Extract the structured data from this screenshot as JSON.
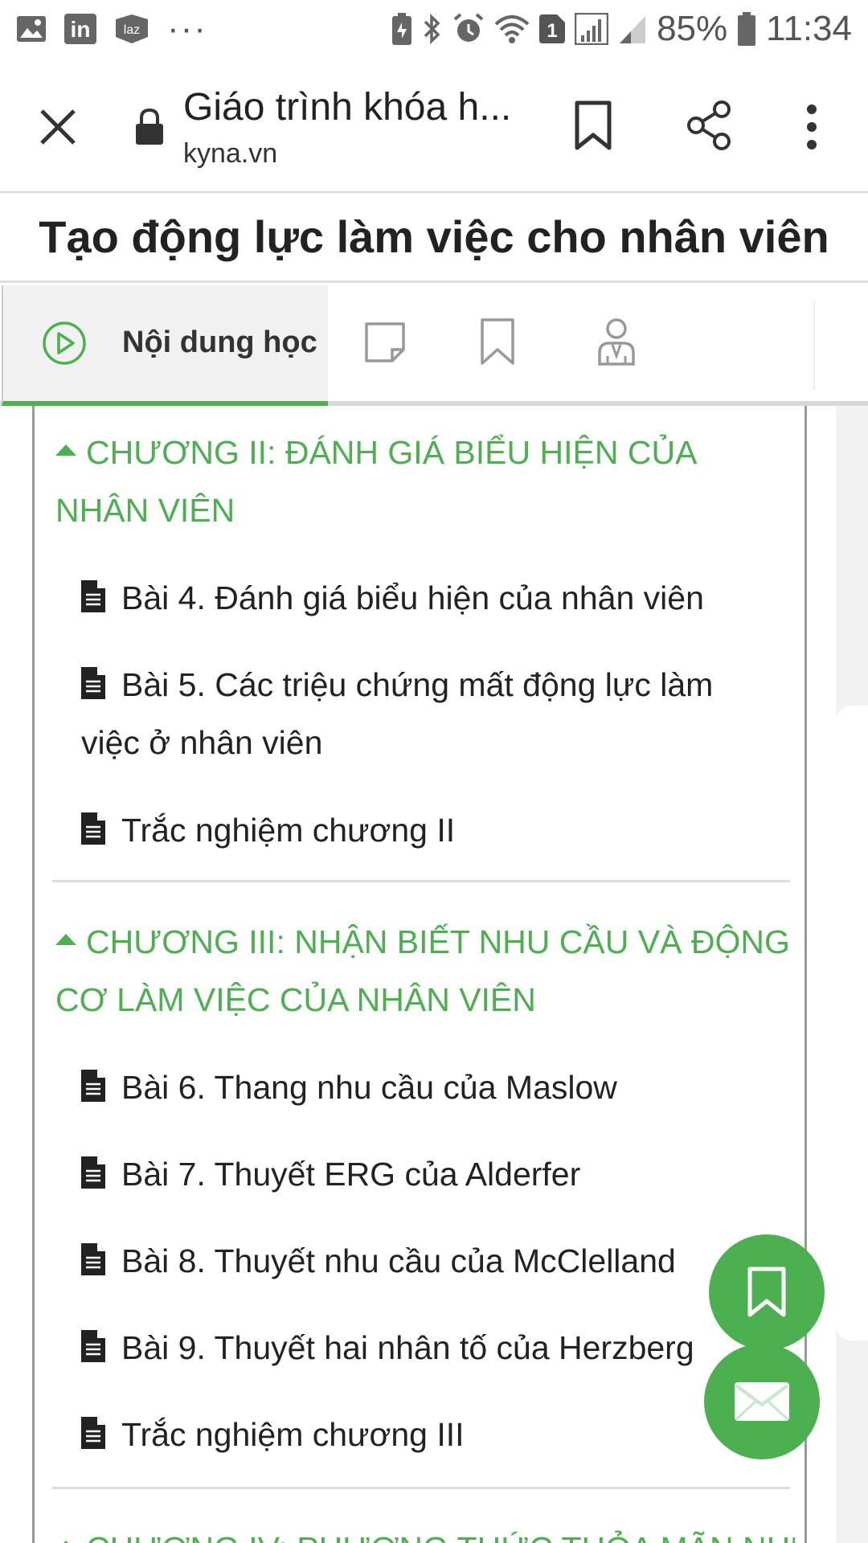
{
  "status_bar": {
    "icons_left": [
      "image-icon",
      "linkedin-icon",
      "lazada-icon",
      "more-dots-icon"
    ],
    "linkedin_label": "in",
    "lazada_label": "laz",
    "dots": "···",
    "battery_percent": "85%",
    "time": "11:34",
    "sim_badge": "1"
  },
  "browser": {
    "page_title": "Giáo trình khóa h...",
    "url": "kyna.vn"
  },
  "course": {
    "title": "Tạo động lực làm việc cho nhân viên"
  },
  "tabs": {
    "active_label": "Nội dung học"
  },
  "chapters": [
    {
      "title": "CHƯƠNG II: ĐÁNH GIÁ BIỂU HIỆN CỦA NHÂN VIÊN",
      "lessons": [
        "Bài 4. Đánh giá biểu hiện của nhân viên",
        "Bài 5. Các triệu chứng mất động lực làm việc ở nhân viên",
        "Trắc nghiệm chương II"
      ]
    },
    {
      "title": "CHƯƠNG III: NHẬN BIẾT NHU CẦU VÀ ĐỘNG CƠ LÀM VIỆC CỦA NHÂN VIÊN",
      "lessons": [
        "Bài 6. Thang nhu cầu của Maslow",
        "Bài 7. Thuyết ERG của Alderfer",
        "Bài 8. Thuyết nhu cầu của McClelland",
        "Bài 9. Thuyết hai nhân tố của Herzberg",
        "Trắc nghiệm chương III"
      ]
    },
    {
      "title": "CHƯƠNG IV: PHƯƠNG THỨC THỎA MÃN NHU"
    }
  ],
  "colors": {
    "accent": "#4caf50",
    "text": "#222222"
  }
}
